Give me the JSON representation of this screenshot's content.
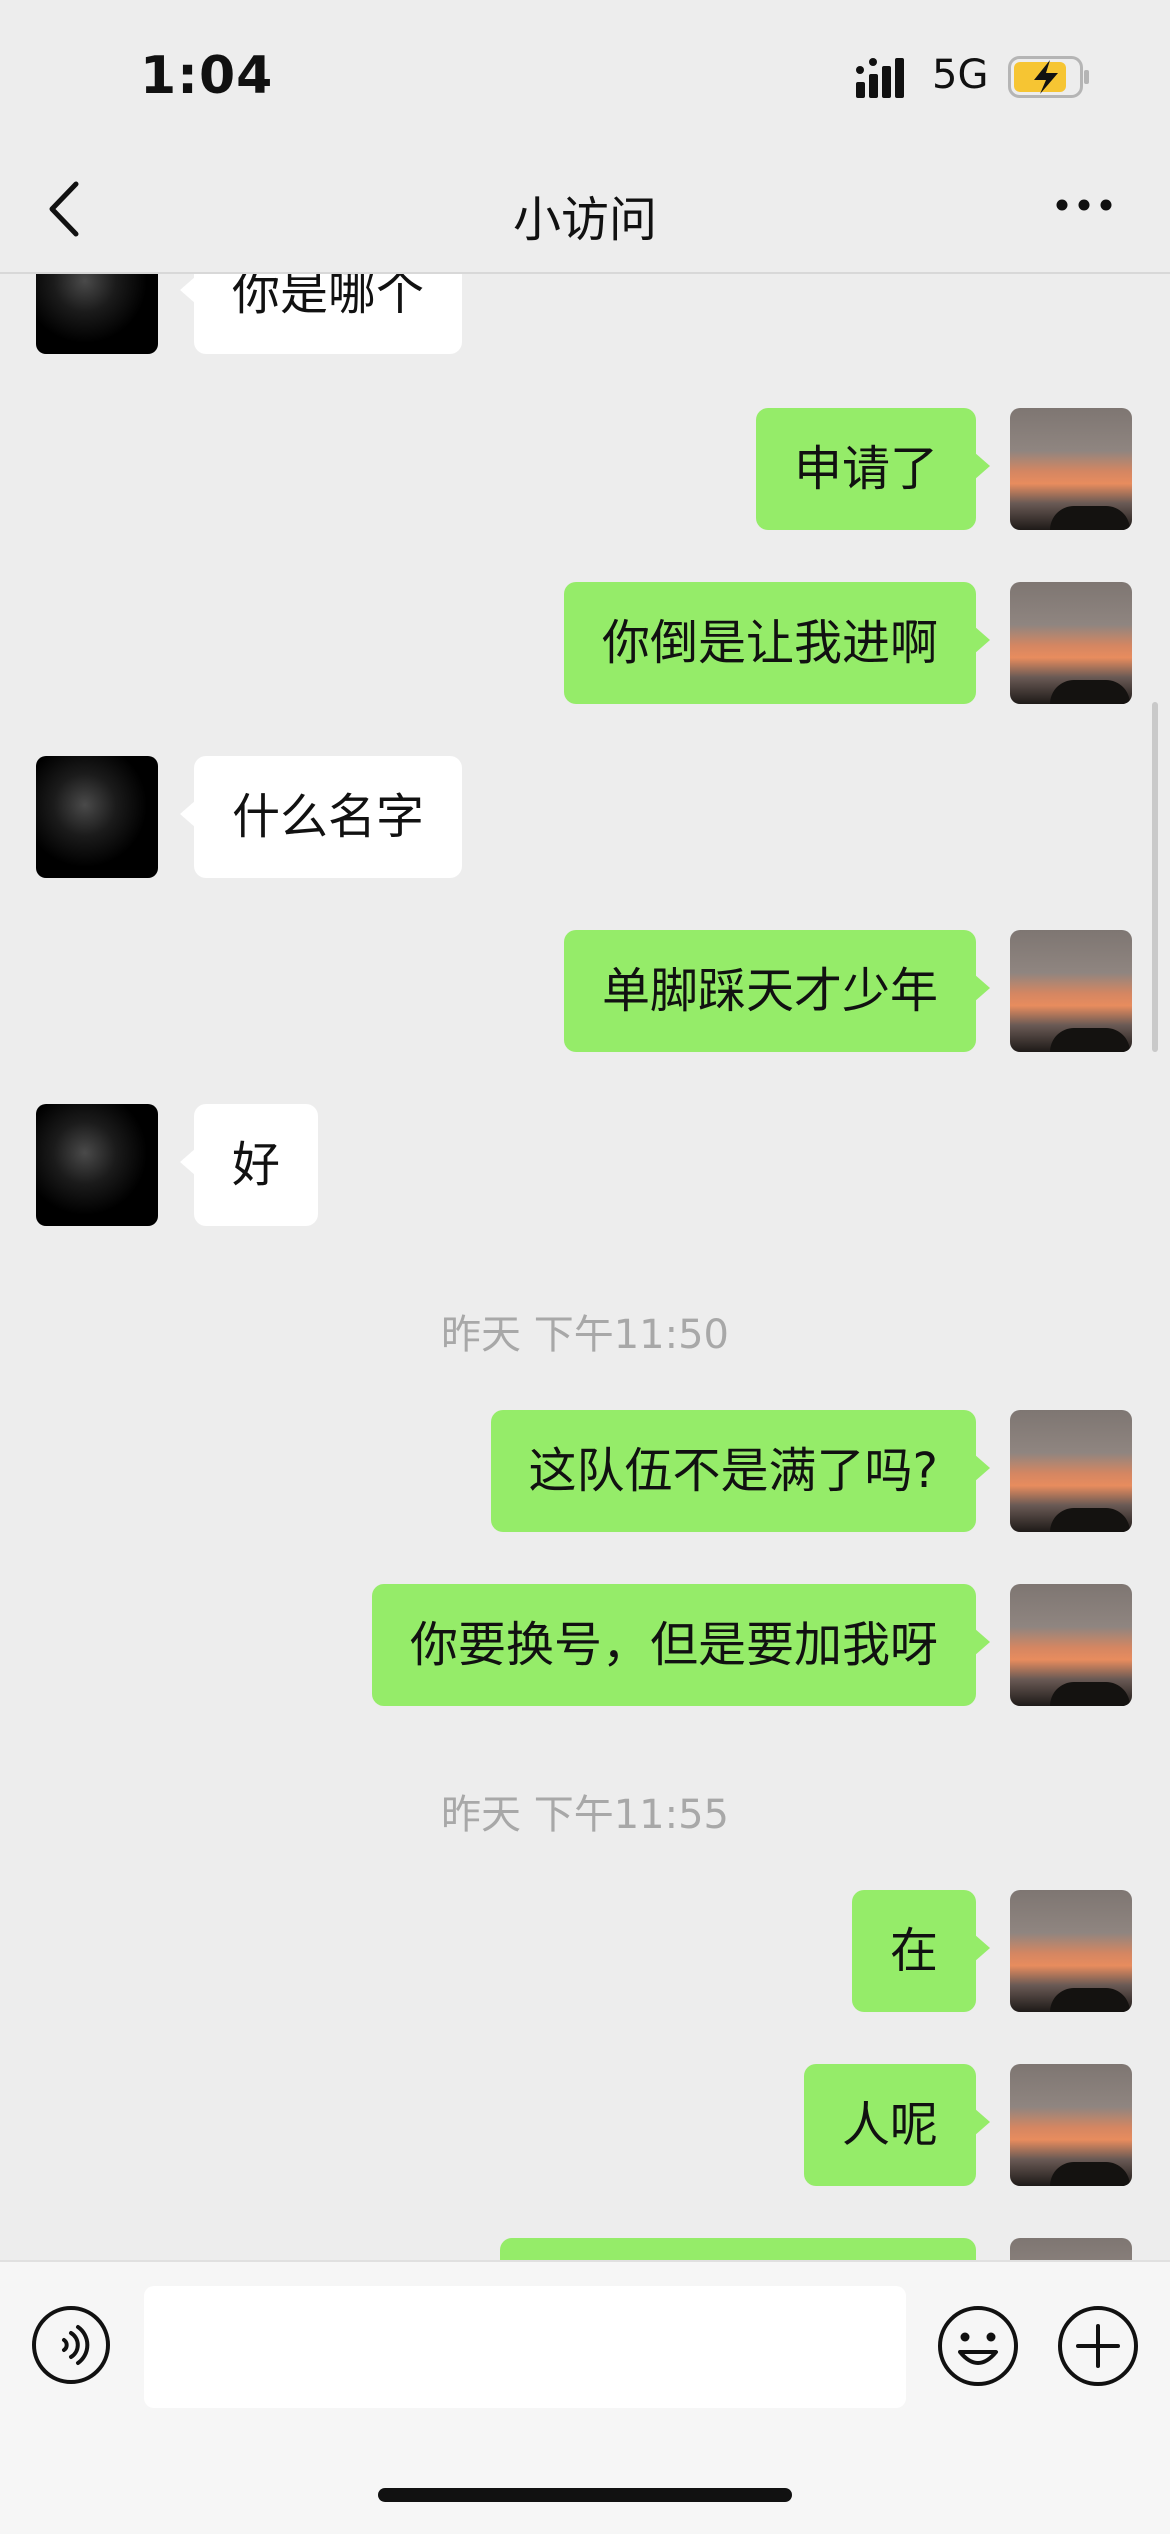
{
  "status_bar": {
    "time": "1:04",
    "network": "5G",
    "signal_icon": "signal-bars-icon",
    "battery_icon": "battery-charging-icon"
  },
  "nav": {
    "title": "小访问",
    "back_icon": "chevron-left-icon",
    "more_icon": "more-dots-icon"
  },
  "messages": [
    {
      "side": "in",
      "text": "你是哪个"
    },
    {
      "side": "out",
      "text": "申请了"
    },
    {
      "side": "out",
      "text": "你倒是让我进啊"
    },
    {
      "side": "in",
      "text": "什么名字"
    },
    {
      "side": "out",
      "text": "单脚踩天才少年"
    },
    {
      "side": "in",
      "text": "好"
    },
    {
      "timestamp": "昨天 下午11:50"
    },
    {
      "side": "out",
      "text": "这队伍不是满了吗?"
    },
    {
      "side": "out",
      "text": "你要换号，但是要加我呀"
    },
    {
      "timestamp": "昨天 下午11:55"
    },
    {
      "side": "out",
      "text": "在"
    },
    {
      "side": "out",
      "text": "人呢"
    },
    {
      "side": "out",
      "text": ""
    }
  ],
  "input_bar": {
    "placeholder": "",
    "voice_icon": "voice-icon",
    "emoji_icon": "emoji-icon",
    "plus_icon": "plus-circle-icon"
  },
  "colors": {
    "background": "#ededed",
    "outgoing_bubble": "#95ec69",
    "incoming_bubble": "#ffffff",
    "timestamp": "#a8a8a8"
  }
}
